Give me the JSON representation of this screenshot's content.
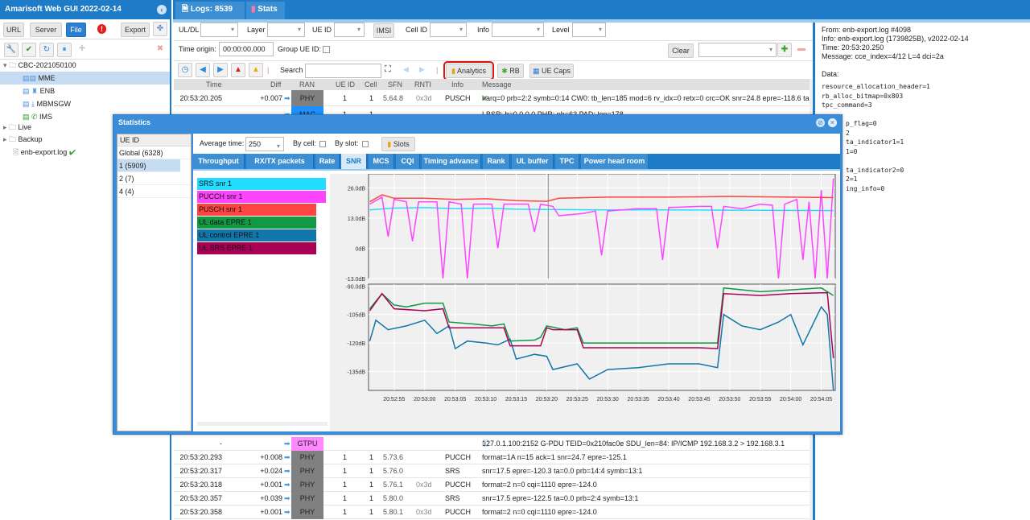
{
  "app": {
    "title": "Amarisoft Web GUI 2022-02-14"
  },
  "left": {
    "buttons": {
      "url": "URL",
      "server": "Server",
      "file": "File",
      "export": "Export"
    },
    "tree": [
      {
        "label": "CBC-2021050100",
        "icon": "folder-icon"
      },
      {
        "label": "MME",
        "icon": "server-icon"
      },
      {
        "label": "ENB",
        "icon": "antenna-icon"
      },
      {
        "label": "MBMSGW",
        "icon": "download-icon"
      },
      {
        "label": "IMS",
        "icon": "phone-icon"
      },
      {
        "label": "Live",
        "icon": "folder-icon"
      },
      {
        "label": "Backup",
        "icon": "folder-icon"
      },
      {
        "label": "enb-export.log",
        "icon": "file-icon"
      }
    ]
  },
  "tabs": [
    {
      "label": "Logs: 8539"
    },
    {
      "label": "Stats"
    }
  ],
  "filters": {
    "uldl": "UL/DL",
    "layer": "Layer",
    "ueid": "UE ID",
    "imsi": "IMSI",
    "cellid": "Cell ID",
    "info": "Info",
    "level": "Level",
    "time_origin_label": "Time origin:",
    "time_origin": "00:00:00.000",
    "group_ueid": "Group UE ID:",
    "clear": "Clear"
  },
  "toolbar": {
    "search": "Search",
    "analytics": "Analytics",
    "rb": "RB",
    "uecaps": "UE Caps"
  },
  "table": {
    "headers": [
      "Time",
      "Diff",
      "RAN",
      "UE ID",
      "Cell",
      "SFN",
      "RNTI",
      "Info",
      "Message"
    ],
    "top_rows": [
      {
        "time": "20:53:20.205",
        "diff": "+0.007",
        "ran": "PHY",
        "ue": "1",
        "cell": "1",
        "sfn": "5.64.8",
        "rnti": "0x3d",
        "info": "PUSCH",
        "msg": "harq=0 prb=2:2 symb=0:14 CW0: tb_len=185 mod=6 rv_idx=0 retx=0 crc=OK snr=24.8 epre=-118.6 ta"
      },
      {
        "time": "-",
        "diff": "",
        "ran": "MAC",
        "ue": "1",
        "cell": "1",
        "sfn": "",
        "rnti": "",
        "info": "",
        "msg": "LBSR: b=0 0 0 0 PHR: ph=63 PAD: len=178"
      }
    ],
    "bottom_rows": [
      {
        "time": "-",
        "diff": "",
        "ran": "GTPU",
        "ue": "",
        "cell": "",
        "sfn": "",
        "rnti": "",
        "info": "",
        "msg": "127.0.1.100:2152 G-PDU TEID=0x210fac0e SDU_len=84: IP/ICMP 192.168.3.2 > 192.168.3.1"
      },
      {
        "time": "20:53:20.293",
        "diff": "+0.008",
        "ran": "PHY",
        "ue": "1",
        "cell": "1",
        "sfn": "5.73.6",
        "rnti": "",
        "info": "PUCCH",
        "msg": "format=1A n=15 ack=1 snr=24.7 epre=-125.1"
      },
      {
        "time": "20:53:20.317",
        "diff": "+0.024",
        "ran": "PHY",
        "ue": "1",
        "cell": "1",
        "sfn": "5.76.0",
        "rnti": "",
        "info": "SRS",
        "msg": "snr=17.5 epre=-120.3 ta=0.0 prb=14:4 symb=13:1"
      },
      {
        "time": "20:53:20.318",
        "diff": "+0.001",
        "ran": "PHY",
        "ue": "1",
        "cell": "1",
        "sfn": "5.76.1",
        "rnti": "0x3d",
        "info": "PUCCH",
        "msg": "format=2 n=0 cqi=1110 epre=-124.0"
      },
      {
        "time": "20:53:20.357",
        "diff": "+0.039",
        "ran": "PHY",
        "ue": "1",
        "cell": "1",
        "sfn": "5.80.0",
        "rnti": "",
        "info": "SRS",
        "msg": "snr=17.5 epre=-122.5 ta=0.0 prb=2:4 symb=13:1"
      },
      {
        "time": "20:53:20.358",
        "diff": "+0.001",
        "ran": "PHY",
        "ue": "1",
        "cell": "1",
        "sfn": "5.80.1",
        "rnti": "0x3d",
        "info": "PUCCH",
        "msg": "format=2 n=0 cqi=1110 epre=-124.0"
      }
    ]
  },
  "ran_colors": {
    "PHY": "#808080",
    "MAC": "#1e90ff",
    "GTPU": "#ff88ff"
  },
  "detail": {
    "lines": [
      "From: enb-export.log #4098",
      "Info: enb-export.log (1739825B), v2022-02-14",
      "Time: 20:53:20.250",
      "Message: cce_index=4/12 L=4 dci=2a",
      "",
      "Data:"
    ],
    "data_lines": [
      "resource_allocation_header=1",
      "rb_alloc_bitmap=0x803",
      "tpc_command=3",
      "",
      "p_flag=0",
      "2",
      "ta_indicator1=1",
      "1=0",
      "",
      "ta_indicator2=0",
      "2=1",
      "ing_info=0"
    ]
  },
  "stats": {
    "title": "Statistics",
    "ue_header": "UE ID",
    "ues": [
      "Global (6328)",
      "1 (5909)",
      "2 (7)",
      "4 (4)"
    ],
    "selected_ue": 1,
    "avg_label": "Average time:",
    "avg_value": "250",
    "by_cell": "By cell:",
    "by_slot": "By slot:",
    "slots": "Slots",
    "tabs": [
      "Throughput",
      "RX/TX packets",
      "Rate",
      "SNR",
      "MCS",
      "CQI",
      "Timing advance",
      "Rank",
      "UL buffer",
      "TPC",
      "Power head room"
    ],
    "active_tab": 3
  },
  "chart_data": [
    {
      "type": "line",
      "ylim": [
        -13,
        32
      ],
      "yticks": [
        "26.0dB",
        "13.0dB",
        "0dB",
        "-13.0dB"
      ],
      "ytick_values": [
        26,
        13,
        0,
        -13
      ],
      "xticks": [
        "20:52:55",
        "20:53:00",
        "20:53:05",
        "20:53:10",
        "20:53:15",
        "20:53:20",
        "20:53:25",
        "20:53:30",
        "20:53:35",
        "20:53:40",
        "20:53:45",
        "20:53:50",
        "20:53:55",
        "20:54:00",
        "20:54:05"
      ],
      "xlim": [
        "20:52:51",
        "20:54:07"
      ],
      "series": [
        {
          "name": "SRS snr 1",
          "color": "#22ddff",
          "points": [
            [
              "20:52:51",
              16.5
            ],
            [
              "20:52:55",
              17.3
            ],
            [
              "20:53:00",
              17.5
            ],
            [
              "20:53:05",
              17
            ],
            [
              "20:53:10",
              17.3
            ],
            [
              "20:53:15",
              16.8
            ],
            [
              "20:53:20",
              16.7
            ],
            [
              "20:53:25",
              16.6
            ],
            [
              "20:53:30",
              16.5
            ],
            [
              "20:53:40",
              16.5
            ],
            [
              "20:53:50",
              16.4
            ],
            [
              "20:54:00",
              16.3
            ],
            [
              "20:54:07",
              16.2
            ]
          ]
        },
        {
          "name": "PUCCH snr 1",
          "color": "#ff44ff",
          "points": [
            [
              "20:52:51",
              19
            ],
            [
              "20:52:53",
              22
            ],
            [
              "20:52:54",
              5
            ],
            [
              "20:52:55",
              21
            ],
            [
              "20:52:57",
              20
            ],
            [
              "20:52:58",
              3
            ],
            [
              "20:52:59",
              20
            ],
            [
              "20:53:02",
              20
            ],
            [
              "20:53:03",
              -13
            ],
            [
              "20:53:04",
              20
            ],
            [
              "20:53:06",
              19
            ],
            [
              "20:53:07",
              -13
            ],
            [
              "20:53:08",
              19
            ],
            [
              "20:53:11",
              19
            ],
            [
              "20:53:12",
              0
            ],
            [
              "20:53:13",
              19
            ],
            [
              "20:53:17",
              19
            ],
            [
              "20:53:18",
              7
            ],
            [
              "20:53:19",
              19
            ],
            [
              "20:53:21",
              18
            ],
            [
              "20:53:22",
              14
            ],
            [
              "20:53:24",
              14.5
            ],
            [
              "20:53:26",
              15
            ],
            [
              "20:53:28",
              16
            ],
            [
              "20:53:29",
              -3
            ],
            [
              "20:53:30",
              16
            ],
            [
              "20:53:35",
              17
            ],
            [
              "20:53:38",
              17
            ],
            [
              "20:53:39",
              -5
            ],
            [
              "20:53:40",
              17.5
            ],
            [
              "20:53:45",
              18
            ],
            [
              "20:53:47",
              18
            ],
            [
              "20:53:48",
              0
            ],
            [
              "20:53:49",
              18
            ],
            [
              "20:53:52",
              17
            ],
            [
              "20:53:55",
              19
            ],
            [
              "20:53:57",
              18.5
            ],
            [
              "20:53:58",
              -13
            ],
            [
              "20:53:59",
              19
            ],
            [
              "20:54:01",
              21
            ],
            [
              "20:54:02",
              -5
            ],
            [
              "20:54:03",
              20
            ],
            [
              "20:54:04",
              -13
            ],
            [
              "20:54:05",
              25
            ],
            [
              "20:54:06",
              -13
            ],
            [
              "20:54:07",
              30
            ]
          ]
        },
        {
          "name": "PUSCH snr 1",
          "color": "#ff4444",
          "points": [
            [
              "20:52:51",
              20
            ],
            [
              "20:52:53",
              23
            ],
            [
              "20:52:55",
              21.5
            ],
            [
              "20:53:00",
              21.5
            ],
            [
              "20:53:05",
              21
            ],
            [
              "20:53:10",
              21.3
            ],
            [
              "20:53:15",
              20.5
            ],
            [
              "20:53:20",
              20.2
            ],
            [
              "20:53:22",
              21.5
            ],
            [
              "20:53:30",
              22
            ],
            [
              "20:53:40",
              22
            ],
            [
              "20:53:50",
              22.3
            ],
            [
              "20:54:00",
              22
            ],
            [
              "20:54:07",
              21.8
            ]
          ]
        }
      ]
    },
    {
      "type": "line",
      "ylim": [
        -145,
        -89
      ],
      "yticks": [
        "-90.0dB",
        "-105dB",
        "-120dB",
        "-135dB"
      ],
      "ytick_values": [
        -90,
        -105,
        -120,
        -135
      ],
      "xticks": [
        "20:52:55",
        "20:53:00",
        "20:53:05",
        "20:53:10",
        "20:53:15",
        "20:53:20",
        "20:53:25",
        "20:53:30",
        "20:53:35",
        "20:53:40",
        "20:53:45",
        "20:53:50",
        "20:53:55",
        "20:54:00",
        "20:54:05"
      ],
      "xlim": [
        "20:52:51",
        "20:54:07"
      ],
      "series": [
        {
          "name": "UL data EPRE 1",
          "color": "#119944",
          "points": [
            [
              "20:52:51",
              -102
            ],
            [
              "20:52:53",
              -94
            ],
            [
              "20:52:55",
              -100
            ],
            [
              "20:52:57",
              -101
            ],
            [
              "20:53:00",
              -99
            ],
            [
              "20:53:03",
              -99
            ],
            [
              "20:53:04",
              -109
            ],
            [
              "20:53:08",
              -110
            ],
            [
              "20:53:11",
              -111
            ],
            [
              "20:53:13",
              -110
            ],
            [
              "20:53:14",
              -119
            ],
            [
              "20:53:18",
              -118.5
            ],
            [
              "20:53:19",
              -117
            ],
            [
              "20:53:20",
              -111
            ],
            [
              "20:53:23",
              -113
            ],
            [
              "20:53:25",
              -112
            ],
            [
              "20:53:26",
              -120
            ],
            [
              "20:53:35",
              -120
            ],
            [
              "20:53:45",
              -120
            ],
            [
              "20:53:48",
              -120
            ],
            [
              "20:53:49",
              -91
            ],
            [
              "20:53:55",
              -93
            ],
            [
              "20:54:00",
              -92
            ],
            [
              "20:54:05",
              -91
            ],
            [
              "20:54:07",
              -95
            ]
          ]
        },
        {
          "name": "UL control EPRE 1",
          "color": "#1177aa",
          "points": [
            [
              "20:52:51",
              -119
            ],
            [
              "20:52:52",
              -108
            ],
            [
              "20:52:54",
              -113
            ],
            [
              "20:52:57",
              -111
            ],
            [
              "20:53:00",
              -108
            ],
            [
              "20:53:02",
              -115
            ],
            [
              "20:53:04",
              -111
            ],
            [
              "20:53:05",
              -123
            ],
            [
              "20:53:07",
              -119
            ],
            [
              "20:53:10",
              -120
            ],
            [
              "20:53:12",
              -121
            ],
            [
              "20:53:14",
              -118
            ],
            [
              "20:53:15",
              -128.5
            ],
            [
              "20:53:18",
              -126
            ],
            [
              "20:53:20",
              -127
            ],
            [
              "20:53:21",
              -134
            ],
            [
              "20:53:25",
              -131
            ],
            [
              "20:53:27",
              -139
            ],
            [
              "20:53:30",
              -134
            ],
            [
              "20:53:35",
              -133
            ],
            [
              "20:53:40",
              -131
            ],
            [
              "20:53:45",
              -131
            ],
            [
              "20:53:48",
              -133
            ],
            [
              "20:53:49",
              -105
            ],
            [
              "20:53:52",
              -111
            ],
            [
              "20:53:55",
              -113
            ],
            [
              "20:53:58",
              -109
            ],
            [
              "20:54:00",
              -105
            ],
            [
              "20:54:02",
              -121
            ],
            [
              "20:54:05",
              -101
            ],
            [
              "20:54:06",
              -105
            ],
            [
              "20:54:07",
              -145
            ]
          ]
        },
        {
          "name": "UL SRS EPRE 1",
          "color": "#aa0055",
          "points": [
            [
              "20:52:51",
              -103
            ],
            [
              "20:52:53",
              -94
            ],
            [
              "20:52:55",
              -102
            ],
            [
              "20:53:00",
              -103
            ],
            [
              "20:53:03",
              -102
            ],
            [
              "20:53:04",
              -112
            ],
            [
              "20:53:10",
              -112
            ],
            [
              "20:53:13",
              -112
            ],
            [
              "20:53:14",
              -121.5
            ],
            [
              "20:53:19",
              -121.5
            ],
            [
              "20:53:20",
              -112
            ],
            [
              "20:53:21",
              -113
            ],
            [
              "20:53:25",
              -113
            ],
            [
              "20:53:26",
              -122.5
            ],
            [
              "20:53:35",
              -122.5
            ],
            [
              "20:53:45",
              -122.5
            ],
            [
              "20:53:48",
              -123
            ],
            [
              "20:53:49",
              -94
            ],
            [
              "20:53:55",
              -95
            ],
            [
              "20:54:00",
              -94
            ],
            [
              "20:54:06",
              -93.5
            ],
            [
              "20:54:07",
              -128
            ]
          ]
        },
        {
          "name": "UL data EPRE 1",
          "color": "#119944",
          "points": []
        }
      ]
    }
  ]
}
